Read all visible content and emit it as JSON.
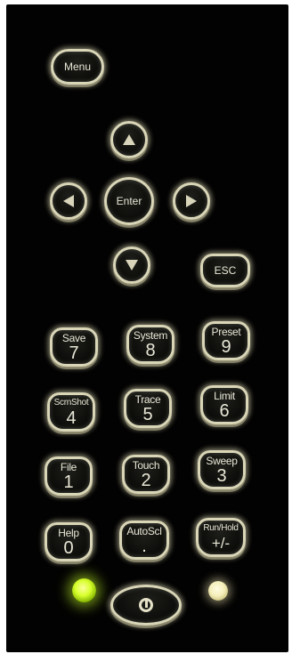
{
  "keys": {
    "menu": "Menu",
    "enter": "Enter",
    "esc": "ESC",
    "save": {
      "top": "Save",
      "num": "7"
    },
    "system": {
      "top": "System",
      "num": "8"
    },
    "preset": {
      "top": "Preset",
      "num": "9"
    },
    "scrnshot": {
      "top": "ScrnShot",
      "num": "4"
    },
    "trace": {
      "top": "Trace",
      "num": "5"
    },
    "limit": {
      "top": "Limit",
      "num": "6"
    },
    "file": {
      "top": "File",
      "num": "1"
    },
    "touch": {
      "top": "Touch",
      "num": "2"
    },
    "sweep": {
      "top": "Sweep",
      "num": "3"
    },
    "help": {
      "top": "Help",
      "num": "0"
    },
    "autoscl": {
      "top": "AutoScl",
      "num": "."
    },
    "runhold": {
      "top": "Run/Hold",
      "num": "+/-"
    }
  },
  "icons": {
    "up": "arrow-up-icon",
    "down": "arrow-down-icon",
    "left": "arrow-left-icon",
    "right": "arrow-right-icon",
    "power": "power-icon"
  },
  "colors": {
    "panel": "#020202",
    "key_outline": "#d9d6b8",
    "led_green": "#d7ff2c",
    "led_white": "#f5eebb"
  }
}
